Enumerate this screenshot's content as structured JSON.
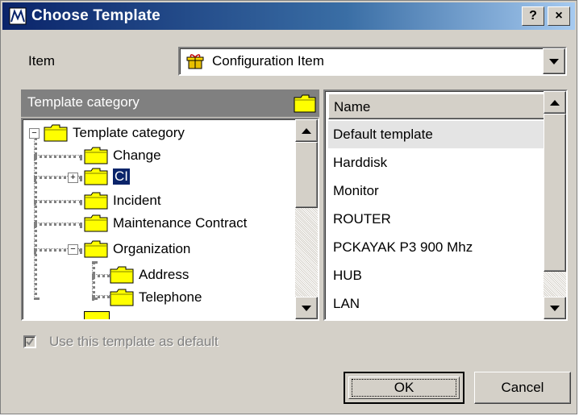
{
  "window": {
    "title": "Choose Template",
    "help_label": "?",
    "close_label": "×"
  },
  "item": {
    "label": "Item",
    "value": "Configuration Item"
  },
  "category_panel": {
    "header": "Template category",
    "tree": [
      {
        "label": "Template category",
        "expander": "−"
      },
      {
        "label": "Change"
      },
      {
        "label": "CI",
        "expander": "+",
        "selected": true
      },
      {
        "label": "Incident"
      },
      {
        "label": "Maintenance Contract"
      },
      {
        "label": "Organization",
        "expander": "−"
      },
      {
        "label": "Address"
      },
      {
        "label": "Telephone"
      }
    ]
  },
  "template_list": {
    "column_header": "Name",
    "rows": [
      {
        "name": "Default template",
        "selected": true
      },
      {
        "name": "Harddisk"
      },
      {
        "name": "Monitor"
      },
      {
        "name": "ROUTER"
      },
      {
        "name": "PCKAYAK P3 900 Mhz"
      },
      {
        "name": "HUB"
      },
      {
        "name": "LAN"
      }
    ]
  },
  "default_checkbox": {
    "label": "Use this template as default",
    "checked": true,
    "enabled": false
  },
  "buttons": {
    "ok": "OK",
    "cancel": "Cancel"
  },
  "colors": {
    "title_start": "#0a246a",
    "title_end": "#a6caf0",
    "dialog_bg": "#d4d0c8",
    "selection": "#0a246a",
    "folder": "#ffff00"
  }
}
